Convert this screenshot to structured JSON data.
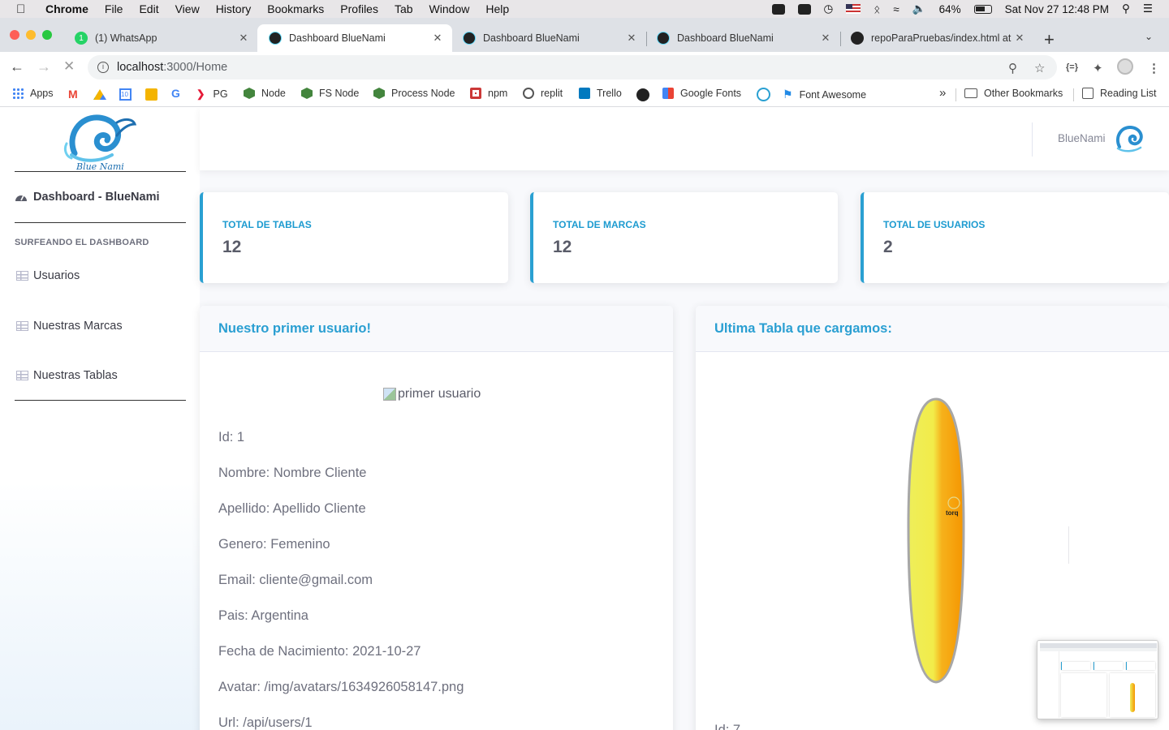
{
  "menubar": {
    "app": "Chrome",
    "items": [
      "File",
      "Edit",
      "View",
      "History",
      "Bookmarks",
      "Profiles",
      "Tab",
      "Window",
      "Help"
    ],
    "battery": "64%",
    "datetime": "Sat Nov 27  12:48 PM"
  },
  "tabs": [
    {
      "title": "(1) WhatsApp",
      "favicon": "whatsapp-icon",
      "badge": "1",
      "active": false
    },
    {
      "title": "Dashboard BlueNami",
      "favicon": "react-icon",
      "active": true
    },
    {
      "title": "Dashboard BlueNami",
      "favicon": "react-icon",
      "active": false
    },
    {
      "title": "Dashboard BlueNami",
      "favicon": "react-icon",
      "active": false
    },
    {
      "title": "repoParaPruebas/index.html at",
      "favicon": "github-icon",
      "active": false
    }
  ],
  "address": {
    "host": "localhost",
    "path": ":3000/Home"
  },
  "bookmarks": {
    "items": [
      "Apps",
      "PG",
      "Node",
      "FS Node",
      "Process Node",
      "npm",
      "replit",
      "Trello",
      "Google Fonts",
      "Font Awesome"
    ],
    "overflow": "»",
    "other": "Other Bookmarks",
    "reading": "Reading List"
  },
  "sidebar": {
    "dashboard_label": "Dashboard - BlueNami",
    "heading": "SURFEANDO EL DASHBOARD",
    "items": [
      {
        "label": "Usuarios"
      },
      {
        "label": "Nuestras Marcas"
      },
      {
        "label": "Nuestras Tablas"
      }
    ]
  },
  "topbar": {
    "username": "BlueNami"
  },
  "stats": [
    {
      "label": "Total de Tablas",
      "value": "12"
    },
    {
      "label": "Total de Marcas",
      "value": "12"
    },
    {
      "label": "Total de Usuarios",
      "value": "2"
    }
  ],
  "user_panel": {
    "title": "Nuestro primer usuario!",
    "image_alt": "primer usuario",
    "fields": [
      "Id: 1",
      "Nombre: Nombre Cliente",
      "Apellido: Apellido Cliente",
      "Genero: Femenino",
      "Email: cliente@gmail.com",
      "Pais: Argentina",
      "Fecha de Nacimiento: 2021-10-27",
      "Avatar: /img/avatars/1634926058147.png",
      "Url: /api/users/1"
    ]
  },
  "table_panel": {
    "title": "Ultima Tabla que cargamos:",
    "partial_field": "Id: 7",
    "board_brand": "torq"
  },
  "colors": {
    "accent": "#2aa0d2",
    "text_muted": "#6e707e",
    "board_yellow": "#f2ef55",
    "board_orange": "#f59a00"
  }
}
